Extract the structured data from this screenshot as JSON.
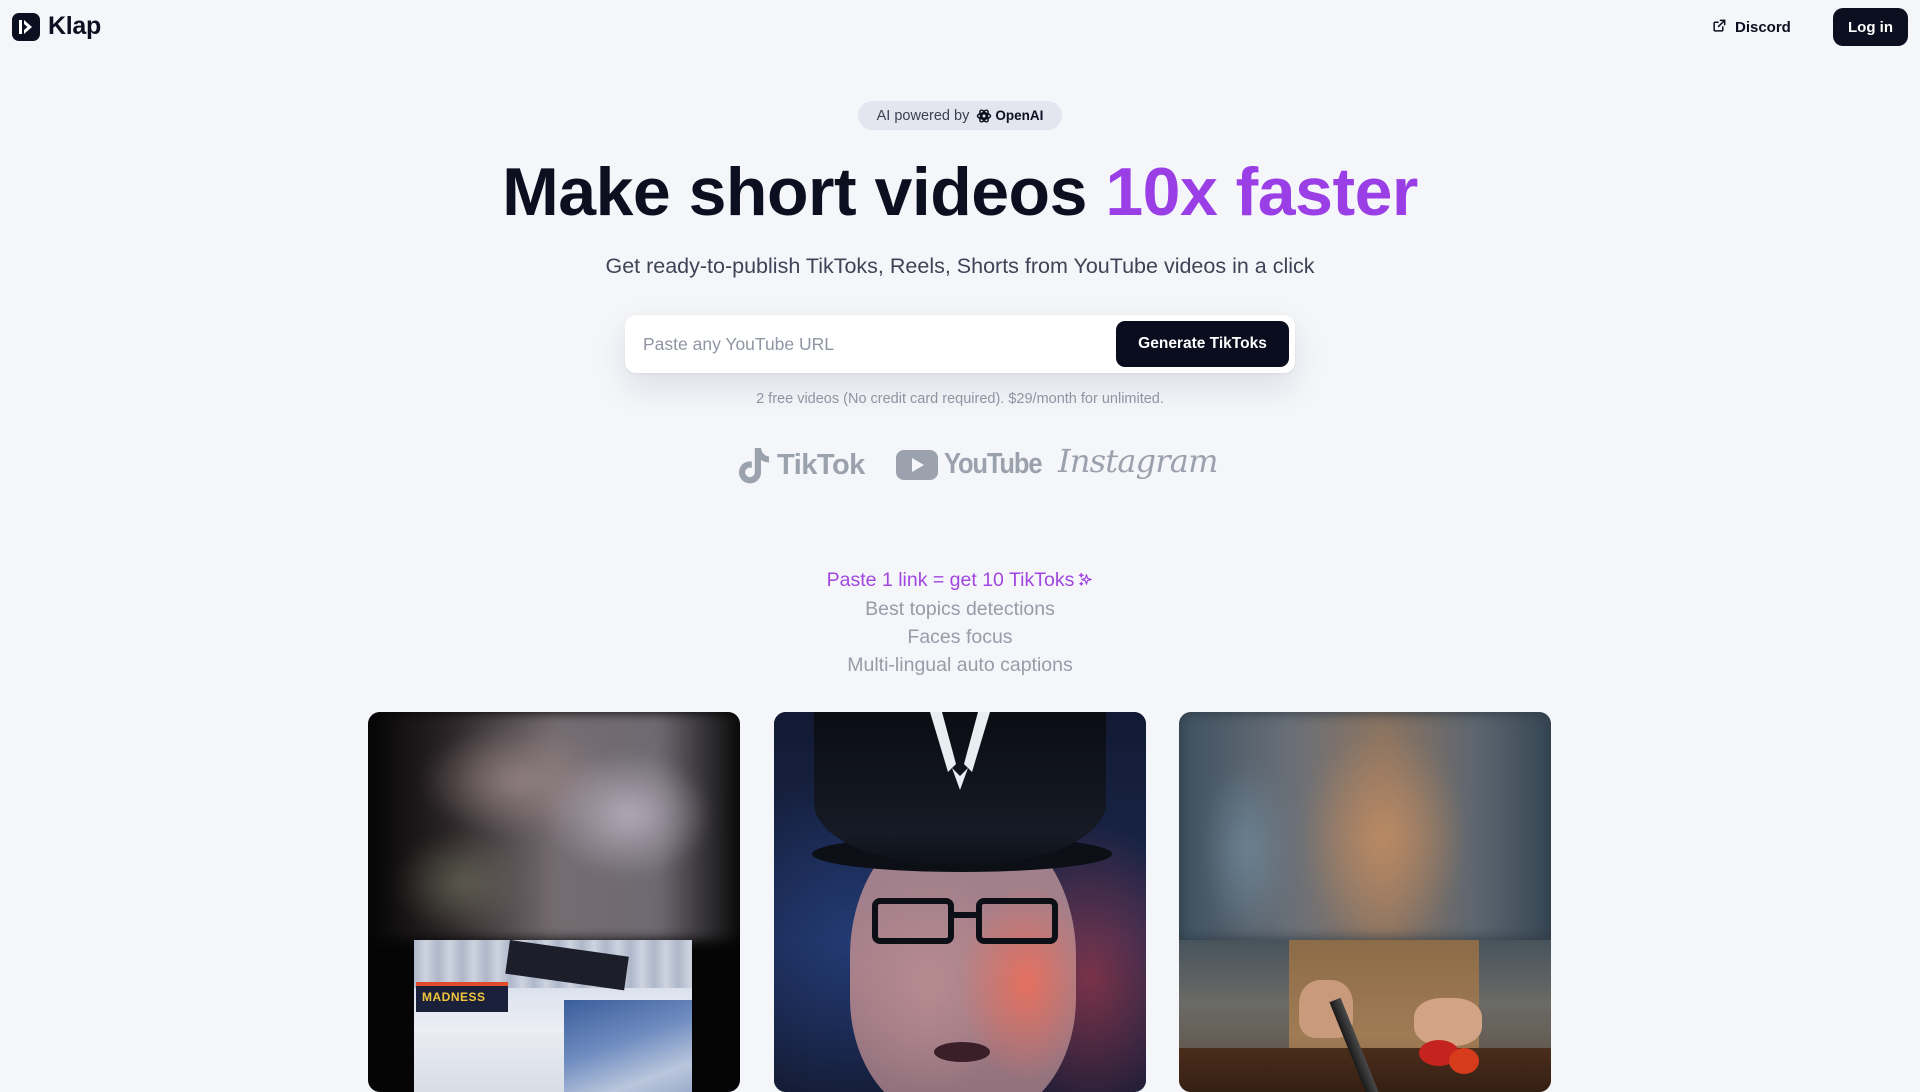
{
  "header": {
    "brand_name": "Klap",
    "discord_label": "Discord",
    "login_label": "Log in"
  },
  "hero": {
    "badge_prefix": "AI powered by",
    "badge_partner": "OpenAI",
    "headline_main": "Make short videos ",
    "headline_accent": "10x faster",
    "subheadline": "Get ready-to-publish TikToks, Reels, Shorts from YouTube videos in a click"
  },
  "url_form": {
    "placeholder": "Paste any YouTube URL",
    "value": "",
    "submit_label": "Generate TikToks"
  },
  "pricing_note": "2 free videos (No credit card required). $29/month for unlimited.",
  "platforms": [
    {
      "name": "TikTok",
      "icon": "tiktok-icon"
    },
    {
      "name": "YouTube",
      "icon": "youtube-icon"
    },
    {
      "name": "Instagram",
      "icon": "instagram-wordmark"
    }
  ],
  "features": [
    {
      "label": "Paste 1 link = get 10 TikToks",
      "active": true,
      "icon": "sparkle-icon"
    },
    {
      "label": "Best topics detections",
      "active": false
    },
    {
      "label": "Faces focus",
      "active": false
    },
    {
      "label": "Multi-lingual auto captions",
      "active": false
    }
  ],
  "video_cards": [
    {
      "name": "store-aisle-video",
      "inset_sign_text": "MADNESS"
    },
    {
      "name": "man-with-cap-video"
    },
    {
      "name": "cooking-video"
    }
  ],
  "colors": {
    "background": "#f4f6fa",
    "dark": "#0c0f1f",
    "accent": "#9a3ee6",
    "muted": "#979ca8"
  }
}
